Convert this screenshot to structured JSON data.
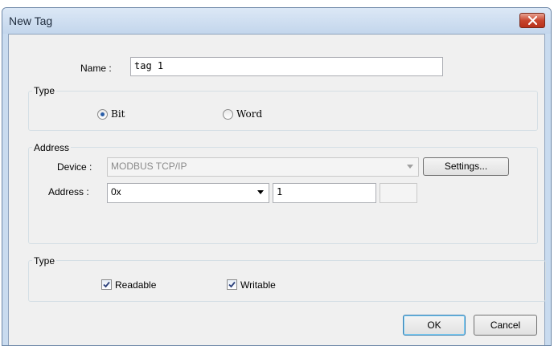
{
  "window": {
    "title": "New Tag",
    "close_icon": "close-x-icon"
  },
  "name": {
    "label": "Name :",
    "value": "tag 1"
  },
  "type_group": {
    "label": "Type",
    "options": [
      {
        "label": "Bit",
        "selected": true
      },
      {
        "label": "Word",
        "selected": false
      }
    ]
  },
  "address_group": {
    "label": "Address",
    "device_label": "Device :",
    "device_value": "MODBUS TCP/IP",
    "settings_label": "Settings...",
    "address_label": "Address :",
    "address_type": "0x",
    "address_value": "1",
    "address_extra": ""
  },
  "access_group": {
    "label": "Type",
    "readable": {
      "label": "Readable",
      "checked": true
    },
    "writable": {
      "label": "Writable",
      "checked": true
    }
  },
  "buttons": {
    "ok": "OK",
    "cancel": "Cancel"
  },
  "colors": {
    "accent": "#2a5ea8",
    "close": "#c8462e"
  }
}
